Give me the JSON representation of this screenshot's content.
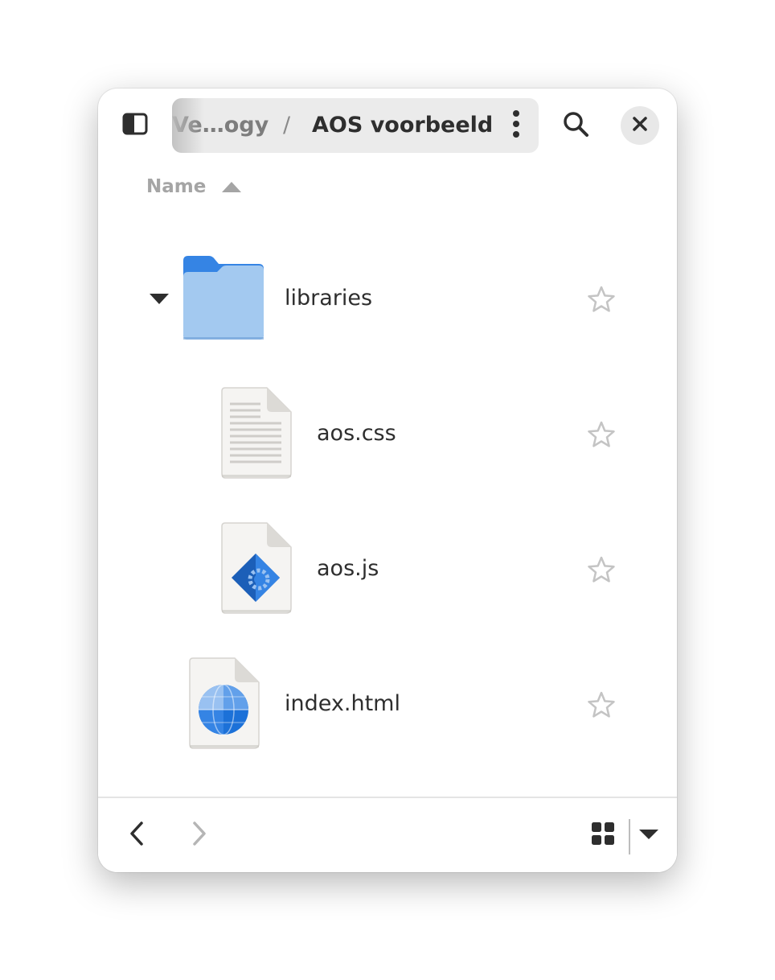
{
  "header": {
    "sidebar_toggle_icon": "sidebar-panel-icon",
    "breadcrumb": {
      "parent": "Ve…ogy",
      "separator": "/",
      "current": "AOS voorbeeld"
    },
    "menu_icon": "vertical-dots-icon",
    "search_icon": "search-icon",
    "close_icon": "close-icon"
  },
  "column_header": {
    "label": "Name",
    "sort_direction": "ascending"
  },
  "files": [
    {
      "name": "libraries",
      "type": "folder",
      "expanded": true,
      "starred": false,
      "icon": "folder-icon"
    },
    {
      "name": "aos.css",
      "type": "text",
      "starred": false,
      "icon": "text-file-icon"
    },
    {
      "name": "aos.js",
      "type": "script",
      "starred": false,
      "icon": "script-file-icon"
    },
    {
      "name": "index.html",
      "type": "html",
      "starred": false,
      "icon": "html-file-icon"
    }
  ],
  "footer": {
    "back_icon": "chevron-left-icon",
    "forward_icon": "chevron-right-icon",
    "forward_enabled": false,
    "view_mode_icon": "grid-view-icon",
    "view_options_icon": "dropdown-arrow-icon"
  },
  "colors": {
    "accent_blue": "#3584e4",
    "folder_light": "#a3c9f0",
    "text_primary": "#2e2e2e",
    "text_muted": "#a5a5a5"
  }
}
